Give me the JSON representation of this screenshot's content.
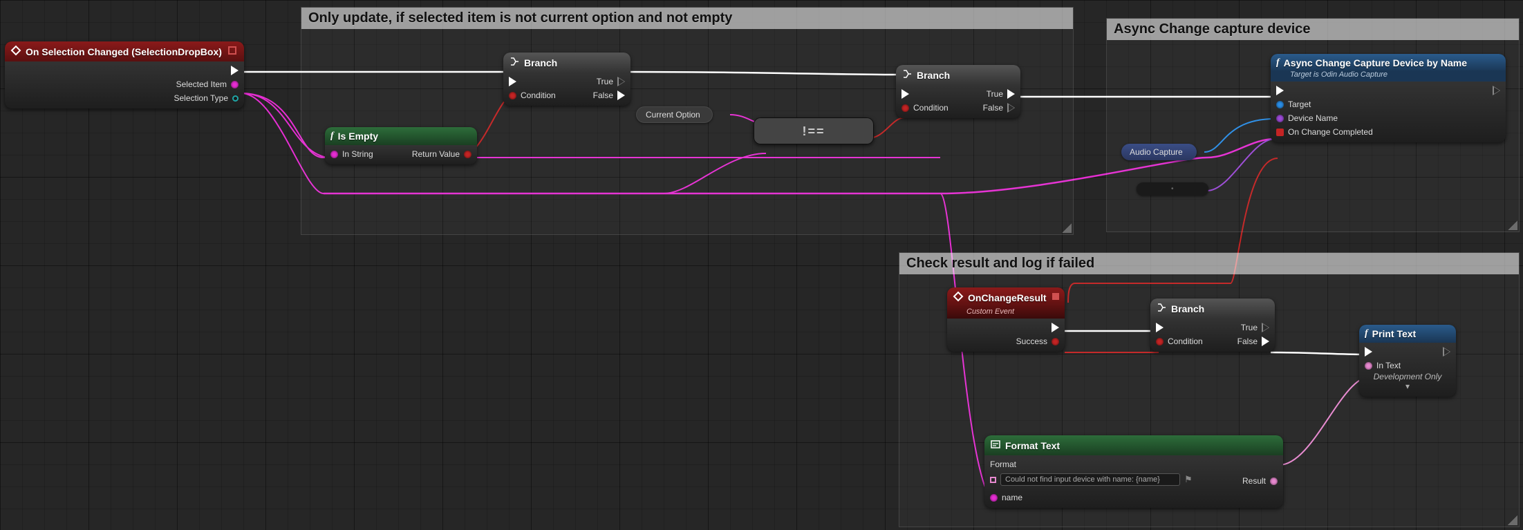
{
  "comments": {
    "update": "Only update, if selected item is not current option and not empty",
    "async": "Async Change capture device",
    "check": "Check result and log if failed"
  },
  "event": {
    "title": "On Selection Changed (SelectionDropBox)",
    "selectedItem": "Selected Item",
    "selectionType": "Selection Type"
  },
  "branch": {
    "title": "Branch",
    "condition": "Condition",
    "true": "True",
    "false": "False"
  },
  "isEmpty": {
    "title": "Is Empty",
    "inString": "In String",
    "returnValue": "Return Value"
  },
  "currentOption": {
    "label": "Current Option"
  },
  "notEqual": {
    "op": "!=="
  },
  "asyncChange": {
    "title": "Async Change Capture Device by Name",
    "subtitle": "Target is Odin Audio Capture",
    "target": "Target",
    "deviceName": "Device Name",
    "onChangeCompleted": "On Change Completed"
  },
  "audioCapture": {
    "label": "Audio Capture"
  },
  "onChangeResult": {
    "title": "OnChangeResult",
    "subtitle": "Custom Event",
    "success": "Success"
  },
  "formatText": {
    "title": "Format Text",
    "formatLabel": "Format",
    "formatValue": "Could not find input device with name: {name}",
    "nameLabel": "name",
    "result": "Result"
  },
  "printText": {
    "title": "Print Text",
    "inText": "In Text",
    "devOnly": "Development Only"
  }
}
